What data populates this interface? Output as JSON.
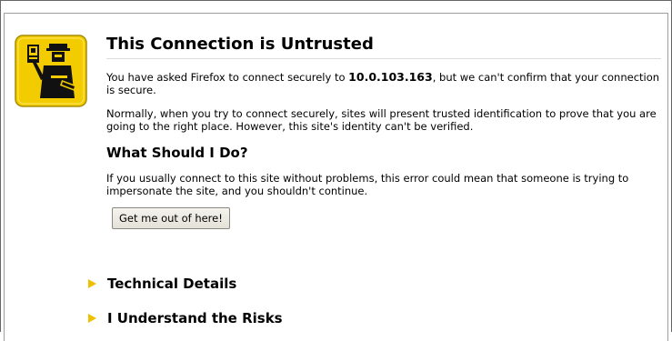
{
  "page": {
    "title": "This Connection is Untrusted",
    "intro_prefix": "You have asked Firefox to connect securely to ",
    "host": "10.0.103.163",
    "intro_suffix": ", but we can't confirm that your connection is secure.",
    "explanation": "Normally, when you try to connect securely, sites will present trusted identification to prove that you are going to the right place. However, this site's identity can't be verified.",
    "what_heading": "What Should I Do?",
    "what_text": "If you usually connect to this site without problems, this error could mean that someone is trying to impersonate the site, and you shouldn't continue.",
    "button_label": "Get me out of here!",
    "sections": [
      {
        "label": "Technical Details"
      },
      {
        "label": "I Understand the Risks"
      }
    ]
  },
  "colors": {
    "icon_yellow": "#f3cc00",
    "expander_arrow": "#f0c000"
  },
  "icons": {
    "main": "security-officer-icon",
    "expander": "triangle-right-icon"
  }
}
